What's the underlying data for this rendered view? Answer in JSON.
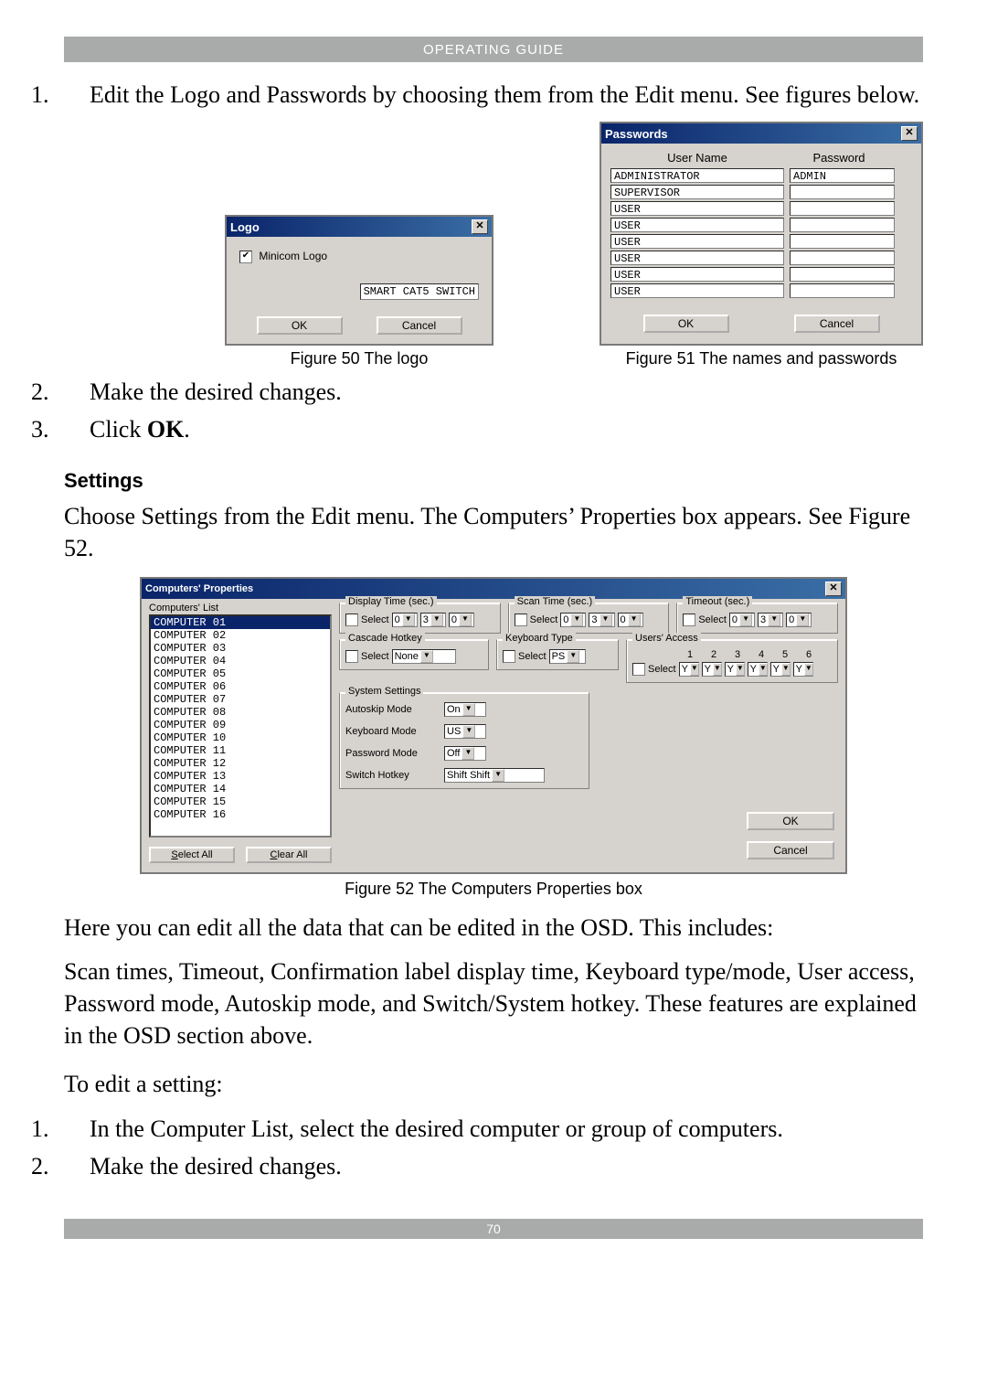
{
  "header": "OPERATING GUIDE",
  "page_number": "70",
  "steps_top": [
    {
      "num": "1.",
      "text": "Edit the Logo and Passwords by choosing them from the Edit menu. See figures below."
    },
    {
      "num": "2.",
      "text": "Make the desired changes."
    },
    {
      "num": "3.",
      "text_prefix": "Click ",
      "text_bold": "OK",
      "text_suffix": "."
    }
  ],
  "logo_dialog": {
    "title": "Logo",
    "checkbox_label": "Minicom Logo",
    "checkbox_checked": "✔",
    "logo_value": "SMART CAT5 SWITCH",
    "ok": "OK",
    "cancel": "Cancel",
    "caption": "Figure  50 The logo"
  },
  "passwords_dialog": {
    "title": "Passwords",
    "col_user": "User Name",
    "col_pass": "Password",
    "rows": [
      {
        "user": "ADMINISTRATOR",
        "pass": "ADMIN"
      },
      {
        "user": "SUPERVISOR",
        "pass": ""
      },
      {
        "user": "USER",
        "pass": ""
      },
      {
        "user": "USER",
        "pass": ""
      },
      {
        "user": "USER",
        "pass": ""
      },
      {
        "user": "USER",
        "pass": ""
      },
      {
        "user": "USER",
        "pass": ""
      },
      {
        "user": "USER",
        "pass": ""
      }
    ],
    "ok": "OK",
    "cancel": "Cancel",
    "caption": "Figure  51 The names and passwords"
  },
  "settings": {
    "heading": "Settings",
    "intro": "Choose Settings from the Edit menu. The Computers’ Properties box appears. See Figure 52."
  },
  "cp": {
    "title": "Computers' Properties",
    "list_label": "Computers' List",
    "list": [
      "COMPUTER 01",
      "COMPUTER 02",
      "COMPUTER 03",
      "COMPUTER 04",
      "COMPUTER 05",
      "COMPUTER 06",
      "COMPUTER 07",
      "COMPUTER 08",
      "COMPUTER 09",
      "COMPUTER 10",
      "COMPUTER 11",
      "COMPUTER 12",
      "COMPUTER 13",
      "COMPUTER 14",
      "COMPUTER 15",
      "COMPUTER 16"
    ],
    "select_all": "Select All",
    "clear_all": "Clear All",
    "display_time": {
      "legend": "Display Time (sec.)",
      "select": "Select",
      "d1": "0",
      "d2": "3",
      "d3": "0"
    },
    "scan_time": {
      "legend": "Scan Time (sec.)",
      "select": "Select",
      "d1": "0",
      "d2": "3",
      "d3": "0"
    },
    "timeout": {
      "legend": "Timeout (sec.)",
      "select": "Select",
      "d1": "0",
      "d2": "3",
      "d3": "0"
    },
    "cascade": {
      "legend": "Cascade Hotkey",
      "select": "Select",
      "value": "None"
    },
    "keyboard_type": {
      "legend": "Keyboard Type",
      "select": "Select",
      "value": "PS"
    },
    "users_access": {
      "legend": "Users' Access",
      "select": "Select",
      "cols": [
        "1",
        "2",
        "3",
        "4",
        "5",
        "6"
      ],
      "vals": [
        "Y",
        "Y",
        "Y",
        "Y",
        "Y",
        "Y"
      ]
    },
    "system": {
      "legend": "System Settings",
      "autoskip_label": "Autoskip Mode",
      "autoskip_value": "On",
      "keyboard_label": "Keyboard Mode",
      "keyboard_value": "US",
      "password_label": "Password Mode",
      "password_value": "Off",
      "switch_label": "Switch Hotkey",
      "switch_value": "Shift Shift"
    },
    "ok": "OK",
    "cancel": "Cancel",
    "caption": "Figure 52 The Computers  Properties box"
  },
  "after": {
    "p1": "Here you can edit all the data that can be edited in the OSD. This includes:",
    "p2": "Scan times, Timeout, Confirmation label display time, Keyboard type/mode, User access, Password mode, Autoskip mode, and Switch/System hotkey. These features are explained in the OSD section above.",
    "p3": "To edit a setting:",
    "steps": [
      {
        "num": "1.",
        "text": "In the Computer List, select the desired computer or group of computers."
      },
      {
        "num": "2.",
        "text": "Make the desired changes."
      }
    ]
  }
}
